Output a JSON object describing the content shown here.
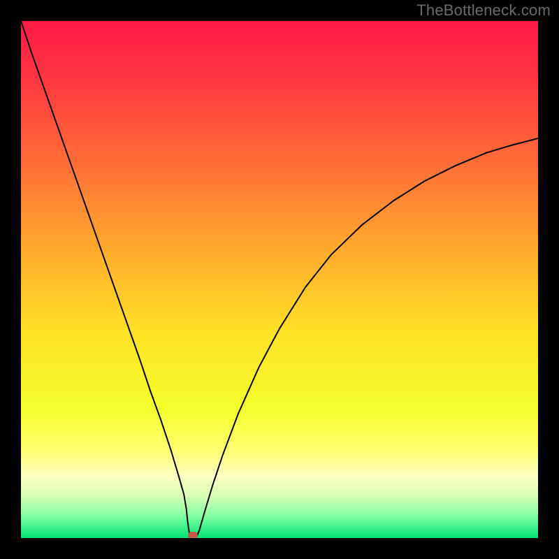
{
  "watermark": {
    "text": "TheBottleneck.com"
  },
  "chart_data": {
    "type": "line",
    "title": "",
    "xlabel": "",
    "ylabel": "",
    "xlim": [
      0,
      100
    ],
    "ylim": [
      0,
      100
    ],
    "grid": false,
    "legend": false,
    "background_gradient_stops": [
      {
        "offset": 0.0,
        "color": "#ff1a46"
      },
      {
        "offset": 0.12,
        "color": "#ff3940"
      },
      {
        "offset": 0.3,
        "color": "#ff7735"
      },
      {
        "offset": 0.45,
        "color": "#ffad2c"
      },
      {
        "offset": 0.6,
        "color": "#ffe126"
      },
      {
        "offset": 0.75,
        "color": "#f4ff2c"
      },
      {
        "offset": 0.83,
        "color": "#ffff70"
      },
      {
        "offset": 0.88,
        "color": "#fdffc0"
      },
      {
        "offset": 0.92,
        "color": "#d6ffb3"
      },
      {
        "offset": 0.96,
        "color": "#7affa0"
      },
      {
        "offset": 1.0,
        "color": "#00e474"
      }
    ],
    "series": [
      {
        "name": "bottleneck-curve",
        "color": "#000000",
        "stroke_width": 2,
        "x": [
          0,
          2,
          5,
          8,
          11,
          14,
          17,
          20,
          23,
          25,
          27,
          29,
          30.5,
          31.5,
          32.0,
          32.2,
          32.4,
          32.6,
          33.0,
          33.5,
          34.0,
          34.5,
          35.5,
          37,
          39,
          42,
          46,
          50,
          55,
          60,
          66,
          72,
          78,
          84,
          90,
          95,
          100
        ],
        "y": [
          100,
          94,
          85.5,
          77,
          68.5,
          60,
          51.5,
          43,
          34.5,
          28.5,
          23,
          17,
          12,
          8.5,
          5.5,
          3.5,
          2.0,
          0.8,
          0.2,
          0.2,
          0.3,
          1.5,
          5,
          10,
          16,
          24,
          33,
          40.5,
          48.5,
          54.8,
          60.6,
          65.2,
          69.0,
          72.0,
          74.5,
          76.0,
          77.3
        ]
      }
    ],
    "marker": {
      "name": "optimal-point",
      "x": 33.2,
      "y": 0.6,
      "color": "#c45a4a"
    }
  }
}
